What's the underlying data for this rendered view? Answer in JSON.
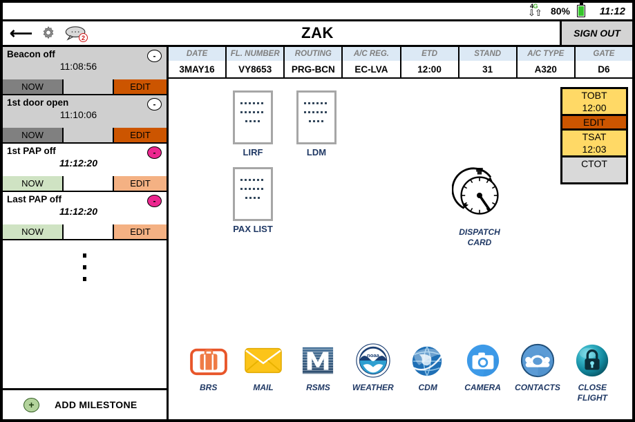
{
  "statusbar": {
    "network": "4G",
    "network_icon": "signal-4g-icon",
    "battery_percent": "80%",
    "battery_icon": "battery-icon",
    "time": "11:12"
  },
  "header": {
    "back_icon": "back-arrow-icon",
    "settings_icon": "gear-icon",
    "messages_icon": "chat-bubble-icon",
    "messages_badge": "2",
    "title": "ZAK",
    "signout_label": "SIGN OUT"
  },
  "milestones": {
    "items": [
      {
        "name": "Beacon off",
        "time": "11:08:56",
        "badge": "-",
        "state": "done",
        "now_label": "NOW",
        "edit_label": "EDIT"
      },
      {
        "name": "1st door open",
        "time": "11:10:06",
        "badge": "-",
        "state": "done",
        "now_label": "NOW",
        "edit_label": "EDIT"
      },
      {
        "name": "1st PAP off",
        "time": "11:12:20",
        "badge": "-",
        "state": "active",
        "now_label": "NOW",
        "edit_label": "EDIT"
      },
      {
        "name": "Last PAP off",
        "time": "11:12:20",
        "badge": "-",
        "state": "active",
        "now_label": "NOW",
        "edit_label": "EDIT"
      }
    ],
    "add_label": "ADD MILESTONE",
    "add_icon": "plus-circle-icon"
  },
  "flight_info": {
    "columns": [
      {
        "header": "DATE",
        "value": "3MAY16"
      },
      {
        "header": "FL. NUMBER",
        "value": "VY8653"
      },
      {
        "header": "ROUTING",
        "value": "PRG-BCN"
      },
      {
        "header": "A/C REG.",
        "value": "EC-LVA"
      },
      {
        "header": "ETD",
        "value": "12:00"
      },
      {
        "header": "STAND",
        "value": "31"
      },
      {
        "header": "A/C TYPE",
        "value": "A320"
      },
      {
        "header": "GATE",
        "value": "D6"
      }
    ]
  },
  "documents": [
    {
      "label": "LIRF",
      "icon": "document-icon"
    },
    {
      "label": "LDM",
      "icon": "document-icon"
    },
    {
      "label": "PAX LIST",
      "icon": "document-icon"
    }
  ],
  "dispatch": {
    "label_line1": "DISPATCH",
    "label_line2": "CARD",
    "icon": "stopwatch-icon"
  },
  "times_panel": {
    "tobt_label": "TOBT",
    "tobt_value": "12:00",
    "edit_label": "EDIT",
    "tsat_label": "TSAT",
    "tsat_value": "12:03",
    "ctot_label": "CTOT"
  },
  "toolbar": {
    "items": [
      {
        "label": "BRS",
        "icon": "suitcase-icon"
      },
      {
        "label": "MAIL",
        "icon": "envelope-icon"
      },
      {
        "label": "RSMS",
        "icon": "m-logo-icon"
      },
      {
        "label": "WEATHER",
        "icon": "noaa-logo-icon"
      },
      {
        "label": "CDM",
        "icon": "globe-icon"
      },
      {
        "label": "CAMERA",
        "icon": "camera-icon"
      },
      {
        "label": "CONTACTS",
        "icon": "telephone-icon"
      },
      {
        "label": "CLOSE",
        "label2": "FLIGHT",
        "icon": "lock-icon"
      }
    ]
  },
  "colors": {
    "accent_orange": "#cc5500",
    "accent_yellow": "#ffd966",
    "accent_pink": "#ec268f",
    "table_header_bg": "#dce9f5",
    "label_blue": "#1f3864"
  }
}
